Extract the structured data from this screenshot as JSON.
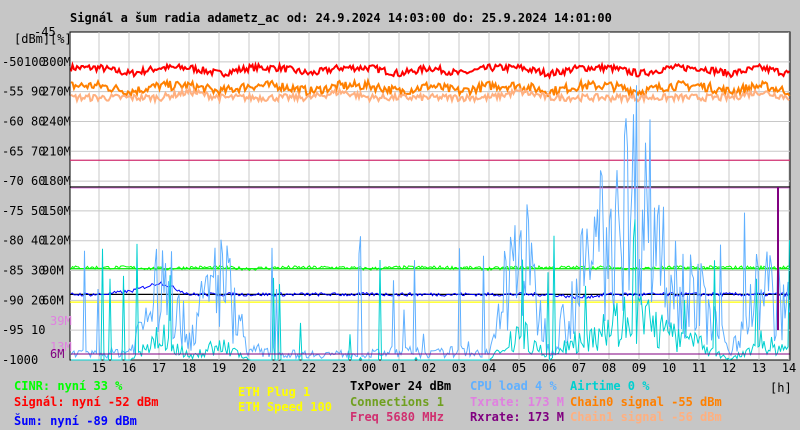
{
  "chart_data": {
    "type": "line",
    "title": "Signál a šum radia adametz_ac od: 24.9.2024 14:03:00 do: 25.9.2024 14:01:00",
    "y_unit_labels": [
      "[dBm]",
      "[%]"
    ],
    "x_unit_label": "[h]",
    "ylim": [
      -100,
      -45
    ],
    "y_ticks_dbm": [
      "-45",
      "-50",
      "-55",
      "-60",
      "-65",
      "-70",
      "-75",
      "-80",
      "-85",
      "-90",
      "-95",
      "-100"
    ],
    "y_ticks_pct": [
      "100",
      "90",
      "80",
      "70",
      "60",
      "50",
      "40",
      "30",
      "20",
      "10",
      "0"
    ],
    "y_ticks_rate": [
      "300M",
      "270M",
      "240M",
      "210M",
      "180M",
      "150M",
      "120M",
      "90M",
      "60M"
    ],
    "extra_rate_ticks": [
      {
        "label": "39M",
        "color": "#e080e0"
      },
      {
        "label": "13M",
        "color": "#e080e0"
      },
      {
        "label": "6M",
        "color": "#800080"
      }
    ],
    "x_ticks": [
      "15",
      "16",
      "17",
      "18",
      "19",
      "20",
      "21",
      "22",
      "23",
      "00",
      "01",
      "02",
      "03",
      "04",
      "05",
      "06",
      "07",
      "08",
      "09",
      "10",
      "11",
      "12",
      "13",
      "14"
    ],
    "hline_series": [
      {
        "name": "Freq",
        "value": -66.5,
        "color": "#d03070"
      },
      {
        "name": "TxPower",
        "value": -71,
        "color": "#000000"
      },
      {
        "name": "CINR avg",
        "value": -84.7,
        "color": "#00e000"
      },
      {
        "name": "Connections",
        "value": -89,
        "color": "#000000"
      },
      {
        "name": "ETH",
        "value": -90.3,
        "color": "#ffff00"
      }
    ],
    "series": [
      {
        "name": "Signál",
        "color": "#ff0000",
        "base": -51.5,
        "jitter": 1.2,
        "values": [
          -51,
          -51,
          -52,
          -51,
          -51,
          -52,
          -51,
          -51,
          -52,
          -51,
          -51,
          -52,
          -51,
          -52,
          -51,
          -51,
          -52,
          -51,
          -51,
          -52,
          -51,
          -51,
          -52,
          -51,
          -52
        ]
      },
      {
        "name": "Chain0 signal",
        "color": "#ff8000",
        "base": -54,
        "jitter": 1.6,
        "values": [
          -54,
          -54,
          -55,
          -54,
          -54,
          -55,
          -54,
          -54,
          -55,
          -54,
          -54,
          -55,
          -54,
          -55,
          -54,
          -54,
          -55,
          -54,
          -54,
          -55,
          -54,
          -54,
          -55,
          -54,
          -55
        ]
      },
      {
        "name": "Chain1 signal",
        "color": "#ffb080",
        "base": -55.5,
        "jitter": 1.2,
        "values": [
          -56,
          -56,
          -56,
          -56,
          -55,
          -56,
          -56,
          -56,
          -56,
          -55,
          -56,
          -56,
          -56,
          -56,
          -56,
          -55,
          -56,
          -56,
          -56,
          -56,
          -56,
          -56,
          -56,
          -55,
          -56
        ]
      },
      {
        "name": "CINR",
        "color": "#00ff00",
        "values": [
          -84.5,
          -84.5,
          -84.5,
          -84.7,
          -84.5,
          -84.5,
          -84.7,
          -84.5,
          -84.5,
          -84.5,
          -84.7,
          -84.5,
          -84.5,
          -84.5,
          -84.7,
          -84.5,
          -84.5,
          -84.5,
          -84.5,
          -84.7,
          -84.5,
          -84.5,
          -84.5,
          -84.5,
          -84.5
        ]
      },
      {
        "name": "Šum",
        "color": "#0000ff",
        "values": [
          -89,
          -89,
          -88.5,
          -87,
          -89,
          -89,
          -89,
          -89,
          -89,
          -89,
          -89,
          -89,
          -89,
          -89,
          -89,
          -89,
          -89,
          -89.5,
          -89,
          -89,
          -89,
          -89,
          -89,
          -89,
          -89
        ]
      },
      {
        "name": "CPU load",
        "color": "#60b0ff",
        "unit": "%",
        "values": [
          2,
          2,
          3,
          25,
          8,
          30,
          3,
          2,
          2,
          2,
          2,
          3,
          2,
          3,
          2,
          40,
          3,
          25,
          45,
          60,
          30,
          20,
          3,
          25,
          15
        ]
      },
      {
        "name": "Airtime",
        "color": "#00d0d0",
        "unit": "%",
        "values": [
          0,
          0,
          0,
          8,
          1,
          5,
          0,
          0,
          0,
          0,
          0,
          0,
          0,
          0,
          0,
          10,
          0,
          8,
          12,
          15,
          8,
          5,
          0,
          6,
          3
        ]
      },
      {
        "name": "Txrate",
        "color": "#e080e0",
        "unit": "M",
        "values": [
          173,
          173,
          173,
          173,
          173,
          173,
          173,
          173,
          173,
          173,
          173,
          173,
          173,
          173,
          173,
          173,
          173,
          173,
          173,
          173,
          173,
          173,
          173,
          173,
          173
        ]
      },
      {
        "name": "Rxrate",
        "color": "#800080",
        "unit": "M",
        "values": [
          6,
          6,
          6,
          6,
          6,
          6,
          6,
          6,
          6,
          6,
          6,
          6,
          6,
          6,
          6,
          6,
          6,
          6,
          6,
          6,
          6,
          6,
          6,
          6,
          6
        ]
      }
    ]
  },
  "legend": {
    "cinr": "CINR: nyní 33 %",
    "signal": "Signál: nyní -52 dBm",
    "noise": "Šum: nyní -89 dBm",
    "eth_plug": "ETH Plug 1",
    "eth_speed": "ETH Speed 100",
    "txpower": "TxPower 24 dBm",
    "connections": "Connections 1",
    "freq": "Freq 5680 MHz",
    "cpu": "CPU load 4 %",
    "txrate": "Txrate: 173 M",
    "rxrate": "Rxrate: 173 M",
    "airtime": "Airtime 0 %",
    "chain0": "Chain0 signal -55 dBm",
    "chain1": "Chain1 signal -56 dBm"
  }
}
